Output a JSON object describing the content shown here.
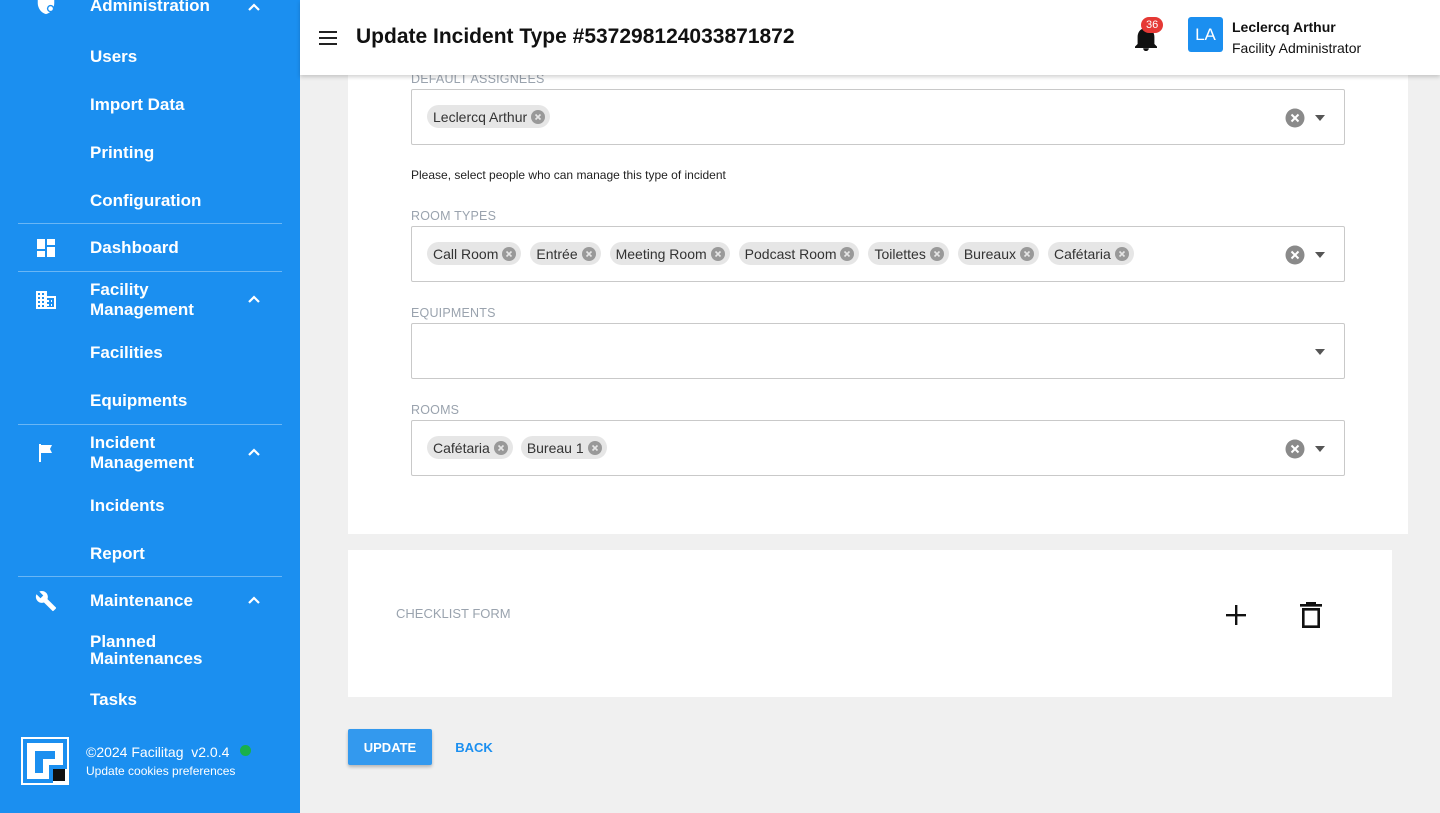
{
  "sidebar": {
    "administration": {
      "title": "Administration",
      "items": [
        "Users",
        "Import Data",
        "Printing",
        "Configuration"
      ]
    },
    "dashboard": {
      "title": "Dashboard"
    },
    "facility": {
      "title_line1": "Facility",
      "title_line2": "Management",
      "items": [
        "Facilities",
        "Equipments"
      ]
    },
    "incident": {
      "title_line1": "Incident",
      "title_line2": "Management",
      "items": [
        "Incidents",
        "Report"
      ]
    },
    "maintenance": {
      "title": "Maintenance",
      "items": [
        "Planned Maintenances",
        "Tasks"
      ],
      "planned_line1": "Planned",
      "planned_line2": "Maintenances"
    },
    "footer": {
      "copyright": "©2024 Facilitag  v2.0.4",
      "cookies": "Update cookies preferences",
      "status_color": "#19b04c"
    }
  },
  "header": {
    "title": "Update Incident Type #537298124033871872",
    "notifications": "36",
    "avatar": "LA",
    "user_name": "Leclercq Arthur",
    "user_role": "Facility Administrator"
  },
  "form": {
    "default_assignees": {
      "label": "DEFAULT ASSIGNEES",
      "chips": [
        "Leclercq Arthur"
      ],
      "helper": "Please, select people who can manage this type of incident"
    },
    "room_types": {
      "label": "ROOM TYPES",
      "chips": [
        "Call Room",
        "Entrée",
        "Meeting Room",
        "Podcast Room",
        "Toilettes",
        "Bureaux",
        "Cafétaria"
      ]
    },
    "equipments": {
      "label": "EQUIPMENTS",
      "chips": []
    },
    "rooms": {
      "label": "ROOMS",
      "chips": [
        "Cafétaria",
        "Bureau 1"
      ]
    }
  },
  "checklist": {
    "label": "CHECKLIST FORM"
  },
  "actions": {
    "update": "UPDATE",
    "back": "BACK"
  },
  "colors": {
    "primary": "#1b8ff0",
    "badge": "#e53935"
  }
}
